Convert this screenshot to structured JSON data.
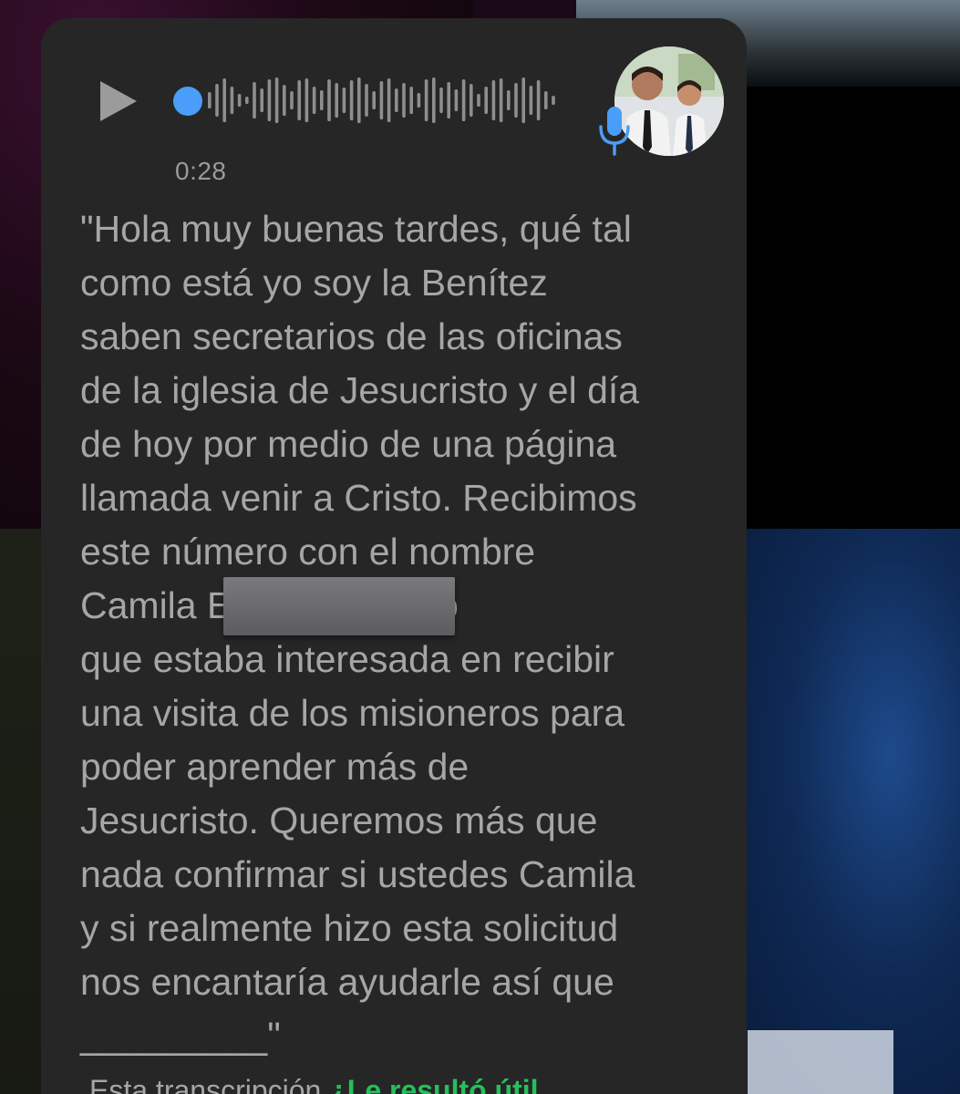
{
  "voice_message": {
    "duration": "0:28",
    "progress": 0.0,
    "colors": {
      "bubble": "#262626",
      "accent": "#4a9df8",
      "text": "#a6a6a6",
      "link": "#25c05a"
    },
    "icons": {
      "play": "play-icon",
      "mic": "microphone-icon"
    }
  },
  "transcript": {
    "text": "\"Hola muy buenas tardes, qué tal\ncomo está yo soy la Benítez\nsaben secretarios de las oficinas\nde la iglesia de Jesucristo y el día\nde hoy por medio de una página\nllamada venir a Cristo. Recibimos\neste número con el nombre\nCamila E                        ni solicitando\nque estaba interesada en recibir\nuna visita de los misioneros para\npoder aprender más de\nJesucristo. Queremos más que\nnada confirmar si ustedes Camila\ny si realmente hizo esta solicitud\nnos encantaría ayudarle así que\n_________\""
  },
  "footer": {
    "prefix": "Esta transcripción",
    "link": "¿Le resultó útil"
  }
}
